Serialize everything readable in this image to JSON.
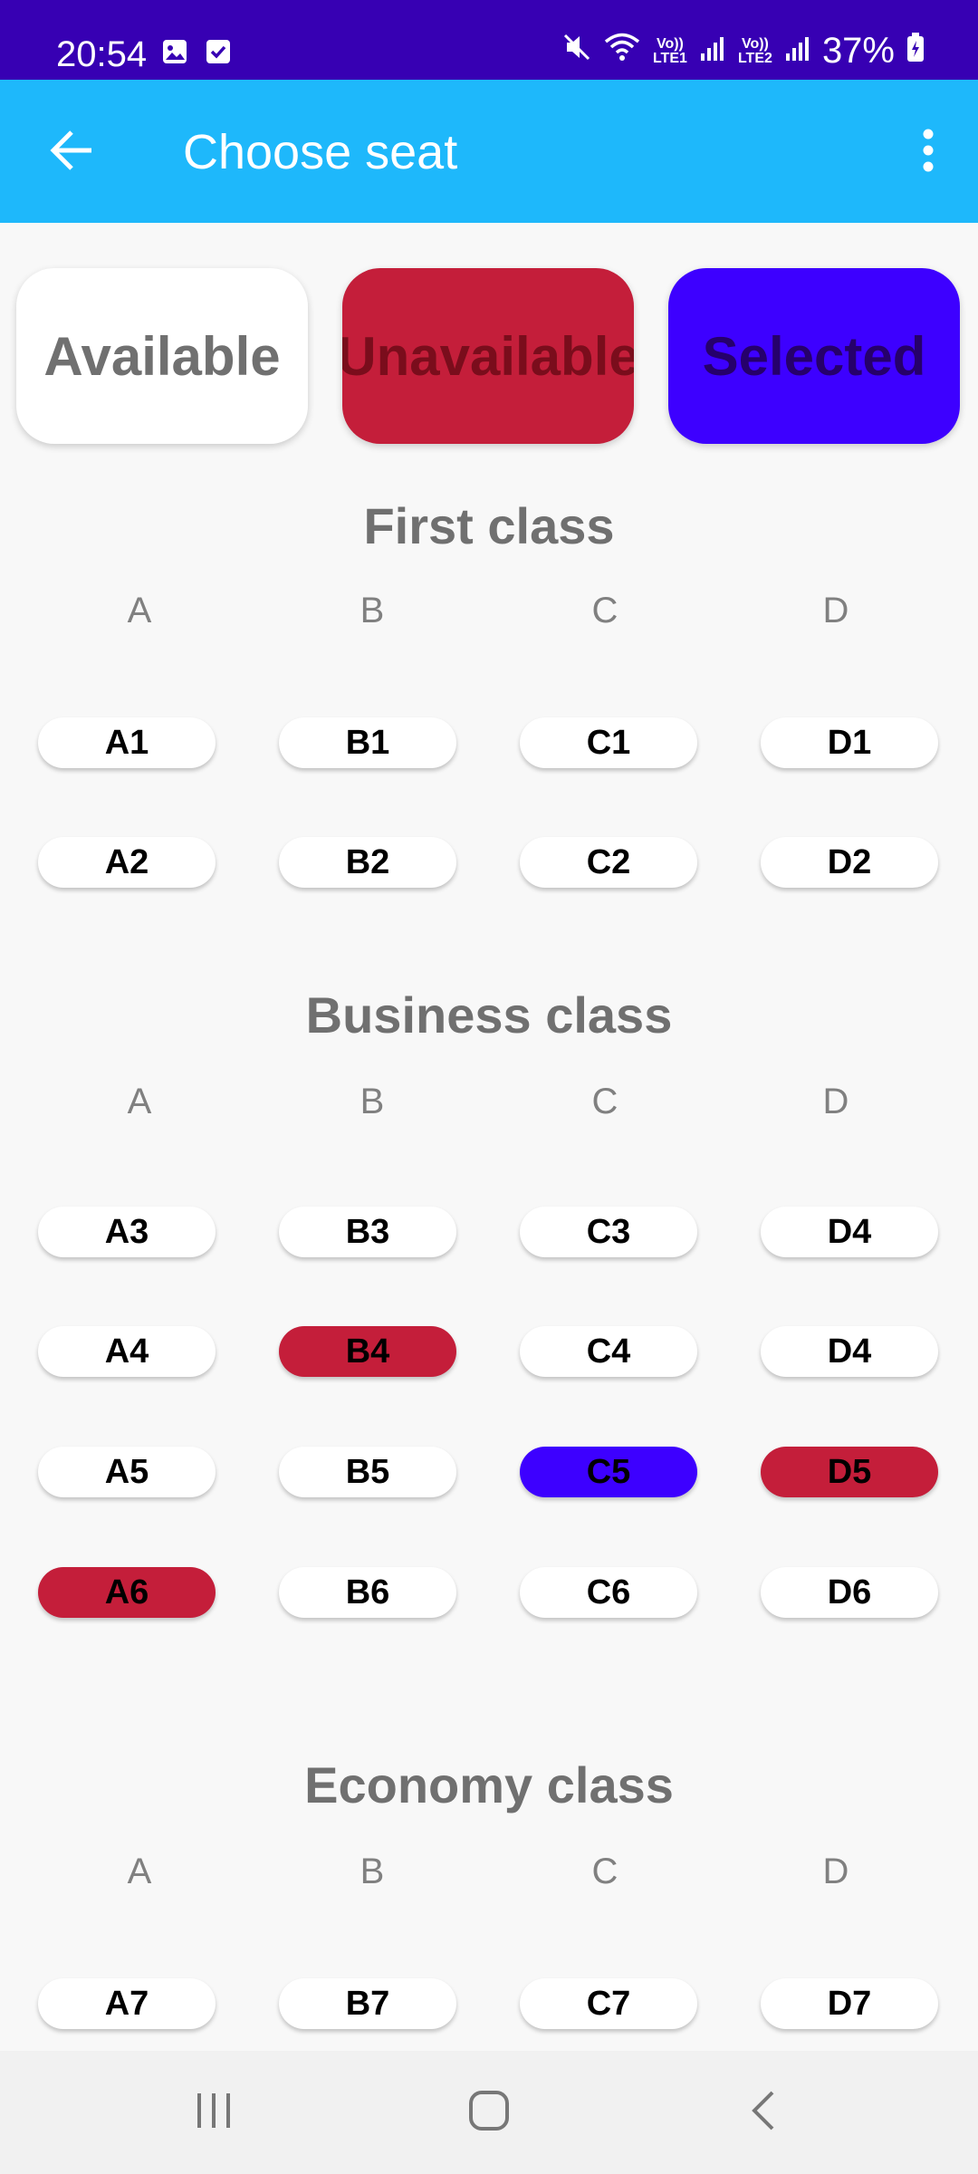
{
  "status_bar": {
    "time": "20:54",
    "battery": "37%",
    "sim1": "Vo)) LTE1",
    "sim2": "Vo)) LTE2",
    "icons": [
      "image-icon",
      "checkbox-icon",
      "mute-icon",
      "wifi-icon",
      "signal-icon",
      "battery-icon"
    ]
  },
  "app_bar": {
    "title": "Choose seat",
    "back_icon": "arrow-left-icon",
    "menu_icon": "more-vert-icon"
  },
  "legend": {
    "available": "Available",
    "unavailable": "Unavailable",
    "selected": "Selected"
  },
  "colors": {
    "status_bar": "#3700b3",
    "app_bar": "#1eb8fb",
    "unavailable": "#c41e3a",
    "selected": "#3d00ff"
  },
  "columns": [
    "A",
    "B",
    "C",
    "D"
  ],
  "sections": [
    {
      "title": "First class",
      "rows": [
        [
          {
            "label": "A1",
            "state": "available"
          },
          {
            "label": "B1",
            "state": "available"
          },
          {
            "label": "C1",
            "state": "available"
          },
          {
            "label": "D1",
            "state": "available"
          }
        ],
        [
          {
            "label": "A2",
            "state": "available"
          },
          {
            "label": "B2",
            "state": "available"
          },
          {
            "label": "C2",
            "state": "available"
          },
          {
            "label": "D2",
            "state": "available"
          }
        ]
      ]
    },
    {
      "title": "Business class",
      "rows": [
        [
          {
            "label": "A3",
            "state": "available"
          },
          {
            "label": "B3",
            "state": "available"
          },
          {
            "label": "C3",
            "state": "available"
          },
          {
            "label": "D4",
            "state": "available"
          }
        ],
        [
          {
            "label": "A4",
            "state": "available"
          },
          {
            "label": "B4",
            "state": "unavailable"
          },
          {
            "label": "C4",
            "state": "available"
          },
          {
            "label": "D4",
            "state": "available"
          }
        ],
        [
          {
            "label": "A5",
            "state": "available"
          },
          {
            "label": "B5",
            "state": "available"
          },
          {
            "label": "C5",
            "state": "selected"
          },
          {
            "label": "D5",
            "state": "unavailable"
          }
        ],
        [
          {
            "label": "A6",
            "state": "unavailable"
          },
          {
            "label": "B6",
            "state": "available"
          },
          {
            "label": "C6",
            "state": "available"
          },
          {
            "label": "D6",
            "state": "available"
          }
        ]
      ]
    },
    {
      "title": "Economy class",
      "rows": [
        [
          {
            "label": "A7",
            "state": "available"
          },
          {
            "label": "B7",
            "state": "available"
          },
          {
            "label": "C7",
            "state": "available"
          },
          {
            "label": "D7",
            "state": "available"
          }
        ]
      ]
    }
  ],
  "nav_bar": {
    "icons": [
      "recent-apps-icon",
      "home-icon",
      "back-icon"
    ]
  }
}
